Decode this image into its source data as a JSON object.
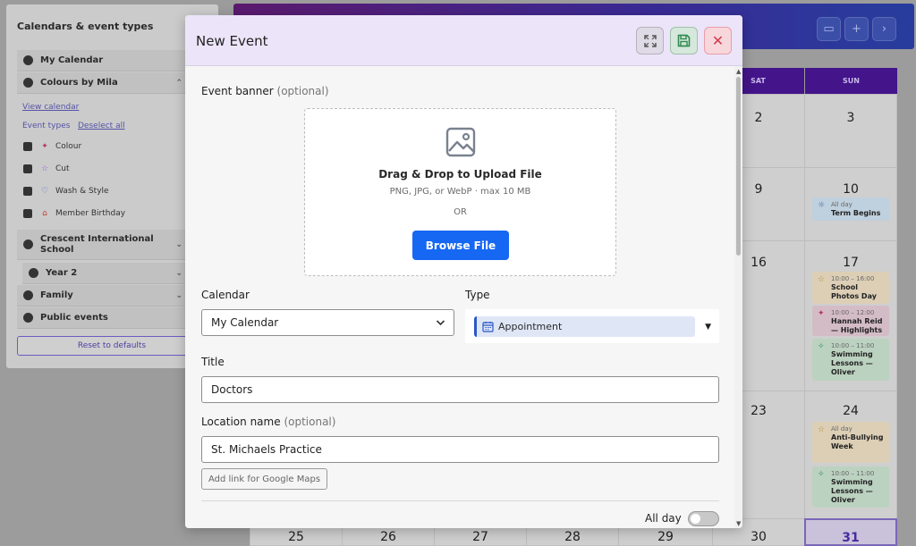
{
  "sidebar": {
    "title": "Calendars & event types",
    "calendars": [
      {
        "label": "My Calendar",
        "checked": true
      },
      {
        "label": "Colours by Mila",
        "checked": true,
        "expanded": true
      }
    ],
    "view_calendar": "View calendar",
    "event_types_label": "Event types",
    "deselect_all": "Deselect all",
    "event_types": [
      {
        "label": "Colour",
        "icon": "sparkle-icon",
        "color": "#b23a5e"
      },
      {
        "label": "Cut",
        "icon": "star-icon",
        "color": "#8c5cc8"
      },
      {
        "label": "Wash & Style",
        "icon": "heart-icon",
        "color": "#4b5fc2"
      },
      {
        "label": "Member Birthday",
        "icon": "gift-icon",
        "color": "#c0392b"
      }
    ],
    "more_calendars": [
      {
        "label": "Crescent International School"
      },
      {
        "label": "Year 2"
      },
      {
        "label": "Family"
      },
      {
        "label": "Public events"
      }
    ],
    "reset_label": "Reset to defaults"
  },
  "calendar": {
    "day_headers": [
      "SAT",
      "SUN"
    ],
    "rows": [
      {
        "sat": "2",
        "sun": "3"
      },
      {
        "sat": "9",
        "sun": "10"
      },
      {
        "sat": "16",
        "sun": "17"
      },
      {
        "sat": "23",
        "sun": "24"
      }
    ],
    "bottom_dates": [
      "25",
      "26",
      "27",
      "28",
      "29",
      "30",
      "31"
    ],
    "events": [
      {
        "time": "All day",
        "name": "Term Begins"
      },
      {
        "time": "10:00 – 16:00",
        "name": "School Photos Day"
      },
      {
        "time": "10:00 – 12:00",
        "name": "Hannah Reid — Highlights"
      },
      {
        "time": "10:00 – 11:00",
        "name": "Swimming Lessons — Oliver"
      },
      {
        "time": "All day",
        "name": "Anti-Bullying Week"
      },
      {
        "time": "10:00 – 11:00",
        "name": "Swimming Lessons — Oliver"
      }
    ]
  },
  "modal": {
    "title": "New Event",
    "banner_label": "Event banner",
    "optional": "(optional)",
    "upload_title": "Drag & Drop to Upload File",
    "upload_sub": "PNG, JPG, or WebP · max 10 MB",
    "or": "OR",
    "browse_label": "Browse File",
    "calendar_label": "Calendar",
    "calendar_value": "My Calendar",
    "type_label": "Type",
    "type_value": "Appointment",
    "title_label": "Title",
    "title_value": "Doctors",
    "location_label": "Location name",
    "location_value": "St. Michaels Practice",
    "maps_link_label": "Add link for Google Maps",
    "all_day_label": "All day",
    "all_day_on": false
  },
  "colors": {
    "primary": "#1668f3",
    "header_purple": "#43148a",
    "close_red": "#d33a4d",
    "save_green": "#2f8a4f"
  }
}
